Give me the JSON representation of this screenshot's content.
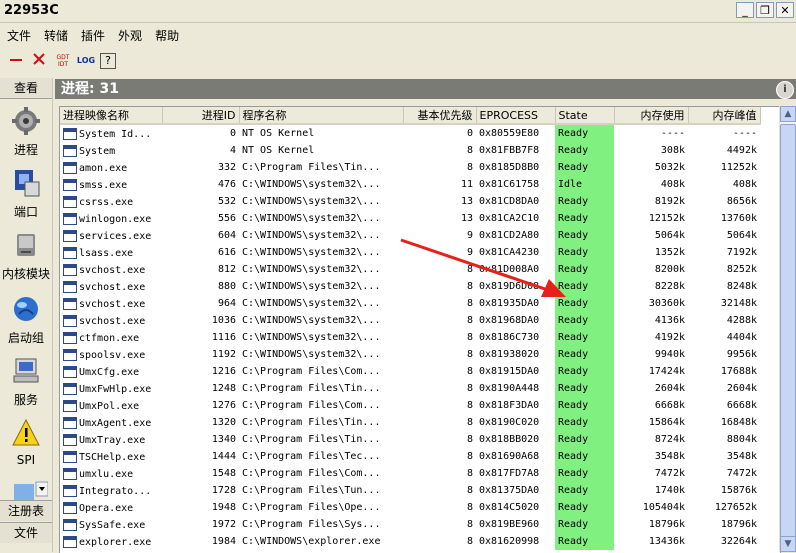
{
  "window": {
    "title": "22953C",
    "min": "_",
    "restore": "❐",
    "close": "✕"
  },
  "menu": [
    "文件",
    "转储",
    "插件",
    "外观",
    "帮助"
  ],
  "toolbar": {
    "gdt_top": "GDT",
    "gdt_bottom": "IDT",
    "log": "LOG",
    "help": "?"
  },
  "sidebar": {
    "header": "查看",
    "items": [
      {
        "label": "进程",
        "icon": "gear-icon"
      },
      {
        "label": "端口",
        "icon": "network-icon"
      },
      {
        "label": "内核模块",
        "icon": "drive-icon"
      },
      {
        "label": "启动组",
        "icon": "globe-icon"
      },
      {
        "label": "服务",
        "icon": "computer-icon"
      },
      {
        "label": "SPI",
        "icon": "warning-icon"
      }
    ],
    "footer1": "注册表",
    "footer2": "文件"
  },
  "main": {
    "title": "进程: 31"
  },
  "table": {
    "columns": [
      "进程映像名称",
      "进程ID",
      "程序名称",
      "基本优先级",
      "EPROCESS",
      "State",
      "内存使用",
      "内存峰值"
    ],
    "rows": [
      [
        "System Id...",
        "0",
        "NT OS Kernel",
        "0",
        "0x80559E80",
        "Ready",
        "----",
        "----"
      ],
      [
        "System",
        "4",
        "NT OS Kernel",
        "8",
        "0x81FBB7F8",
        "Ready",
        "308k",
        "4492k"
      ],
      [
        "amon.exe",
        "332",
        "C:\\Program Files\\Tin...",
        "8",
        "0x8185D8B0",
        "Ready",
        "5032k",
        "11252k"
      ],
      [
        "smss.exe",
        "476",
        "C:\\WINDOWS\\system32\\...",
        "11",
        "0x81C61758",
        "Idle",
        "408k",
        "408k"
      ],
      [
        "csrss.exe",
        "532",
        "C:\\WINDOWS\\system32\\...",
        "13",
        "0x81CD8DA0",
        "Ready",
        "8192k",
        "8656k"
      ],
      [
        "winlogon.exe",
        "556",
        "C:\\WINDOWS\\system32\\...",
        "13",
        "0x81CA2C10",
        "Ready",
        "12152k",
        "13760k"
      ],
      [
        "services.exe",
        "604",
        "C:\\WINDOWS\\system32\\...",
        "9",
        "0x81CD2A80",
        "Ready",
        "5064k",
        "5064k"
      ],
      [
        "lsass.exe",
        "616",
        "C:\\WINDOWS\\system32\\...",
        "9",
        "0x81CA4230",
        "Ready",
        "1352k",
        "7192k"
      ],
      [
        "svchost.exe",
        "812",
        "C:\\WINDOWS\\system32\\...",
        "8",
        "0x81D008A0",
        "Ready",
        "8200k",
        "8252k"
      ],
      [
        "svchost.exe",
        "880",
        "C:\\WINDOWS\\system32\\...",
        "8",
        "0x819D6D08",
        "Ready",
        "8228k",
        "8248k"
      ],
      [
        "svchost.exe",
        "964",
        "C:\\WINDOWS\\system32\\...",
        "8",
        "0x81935DA0",
        "Ready",
        "30360k",
        "32148k"
      ],
      [
        "svchost.exe",
        "1036",
        "C:\\WINDOWS\\system32\\...",
        "8",
        "0x81968DA0",
        "Ready",
        "4136k",
        "4288k"
      ],
      [
        "ctfmon.exe",
        "1116",
        "C:\\WINDOWS\\system32\\...",
        "8",
        "0x8186C730",
        "Ready",
        "4192k",
        "4404k"
      ],
      [
        "spoolsv.exe",
        "1192",
        "C:\\WINDOWS\\system32\\...",
        "8",
        "0x81938020",
        "Ready",
        "9940k",
        "9956k"
      ],
      [
        "UmxCfg.exe",
        "1216",
        "C:\\Program Files\\Com...",
        "8",
        "0x81915DA0",
        "Ready",
        "17424k",
        "17688k"
      ],
      [
        "UmxFwHlp.exe",
        "1248",
        "C:\\Program Files\\Tin...",
        "8",
        "0x8190A448",
        "Ready",
        "2604k",
        "2604k"
      ],
      [
        "UmxPol.exe",
        "1276",
        "C:\\Program Files\\Com...",
        "8",
        "0x818F3DA0",
        "Ready",
        "6668k",
        "6668k"
      ],
      [
        "UmxAgent.exe",
        "1320",
        "C:\\Program Files\\Tin...",
        "8",
        "0x8190C020",
        "Ready",
        "15864k",
        "16848k"
      ],
      [
        "UmxTray.exe",
        "1340",
        "C:\\Program Files\\Tin...",
        "8",
        "0x818BB020",
        "Ready",
        "8724k",
        "8804k"
      ],
      [
        "TSCHelp.exe",
        "1444",
        "C:\\Program Files\\Tec...",
        "8",
        "0x81690A68",
        "Ready",
        "3548k",
        "3548k"
      ],
      [
        "umxlu.exe",
        "1548",
        "C:\\Program Files\\Com...",
        "8",
        "0x817FD7A8",
        "Ready",
        "7472k",
        "7472k"
      ],
      [
        "Integrato...",
        "1728",
        "C:\\Program Files\\Tun...",
        "8",
        "0x81375DA0",
        "Ready",
        "1740k",
        "15876k"
      ],
      [
        "Opera.exe",
        "1948",
        "C:\\Program Files\\Ope...",
        "8",
        "0x814C5020",
        "Ready",
        "105404k",
        "127652k"
      ],
      [
        "SysSafe.exe",
        "1972",
        "C:\\Program Files\\Sys...",
        "8",
        "0x819BE960",
        "Ready",
        "18796k",
        "18796k"
      ],
      [
        "explorer.exe",
        "1984",
        "C:\\WINDOWS\\explorer.exe",
        "8",
        "0x81620998",
        "Ready",
        "13436k",
        "32264k"
      ]
    ]
  }
}
